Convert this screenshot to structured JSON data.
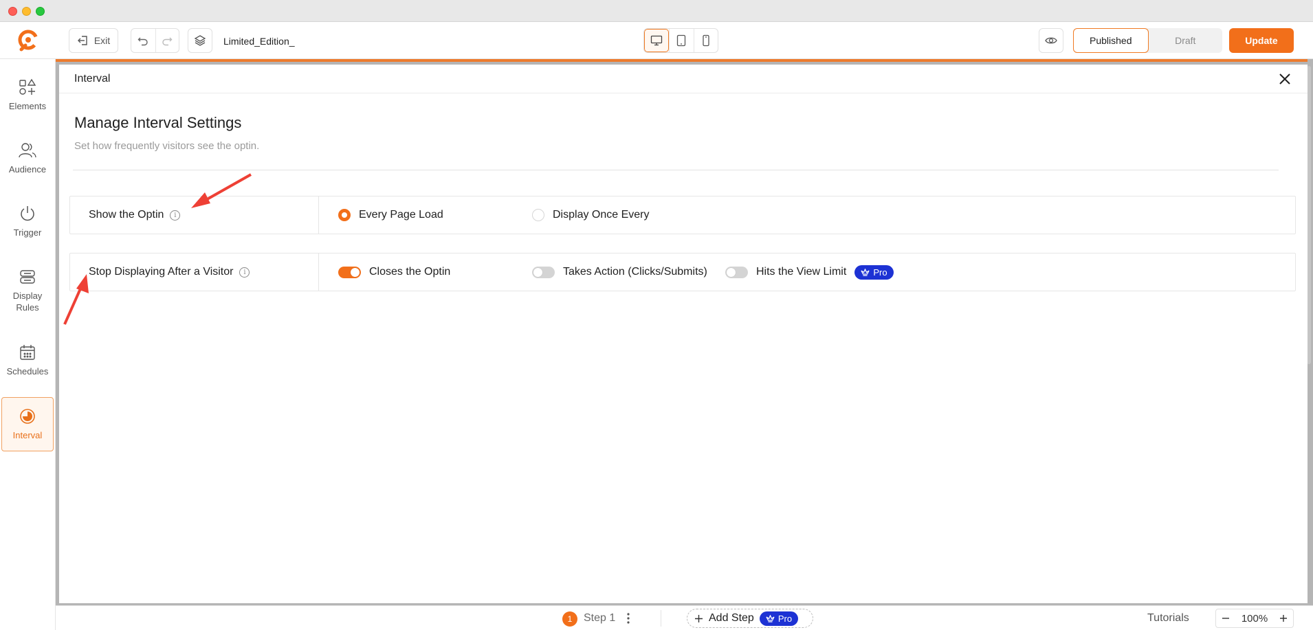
{
  "window": {
    "traffic_lights": [
      "close",
      "minimize",
      "zoom"
    ]
  },
  "toolbar": {
    "exit_label": "Exit",
    "doc_title": "Limited_Edition_",
    "status_published": "Published",
    "status_draft": "Draft",
    "update_label": "Update",
    "icons": [
      "undo-icon",
      "redo-icon",
      "layers-icon",
      "desktop-icon",
      "tablet-icon",
      "mobile-icon",
      "eye-icon"
    ]
  },
  "sidebar": {
    "items": [
      {
        "label": "Elements",
        "icon": "elements-icon"
      },
      {
        "label": "Audience",
        "icon": "users-icon"
      },
      {
        "label": "Trigger",
        "icon": "power-icon"
      },
      {
        "label": "Display Rules",
        "icon": "display-rules-icon"
      },
      {
        "label": "Schedules",
        "icon": "calendar-icon"
      },
      {
        "label": "Interval",
        "icon": "interval-icon",
        "active": true
      }
    ]
  },
  "panel": {
    "title": "Interval",
    "heading": "Manage Interval Settings",
    "subheading": "Set how frequently visitors see the optin.",
    "show_optin": {
      "label": "Show the Optin",
      "options": [
        {
          "label": "Every Page Load",
          "selected": true
        },
        {
          "label": "Display Once Every",
          "selected": false
        }
      ]
    },
    "stop_displaying": {
      "label": "Stop Displaying After a Visitor",
      "toggles": [
        {
          "label": "Closes the Optin",
          "on": true
        },
        {
          "label": "Takes Action (Clicks/Submits)",
          "on": false
        },
        {
          "label": "Hits the View Limit",
          "on": false
        }
      ],
      "pro_badge": "Pro"
    }
  },
  "bottombar": {
    "step_number": "1",
    "step_label": "Step 1",
    "add_step_label": "Add Step",
    "pro_badge": "Pro",
    "tutorials": "Tutorials",
    "zoom_value": "100%"
  },
  "colors": {
    "accent": "#f26f1a",
    "pro": "#1d32d4",
    "annotation_arrow": "#ee4035"
  }
}
